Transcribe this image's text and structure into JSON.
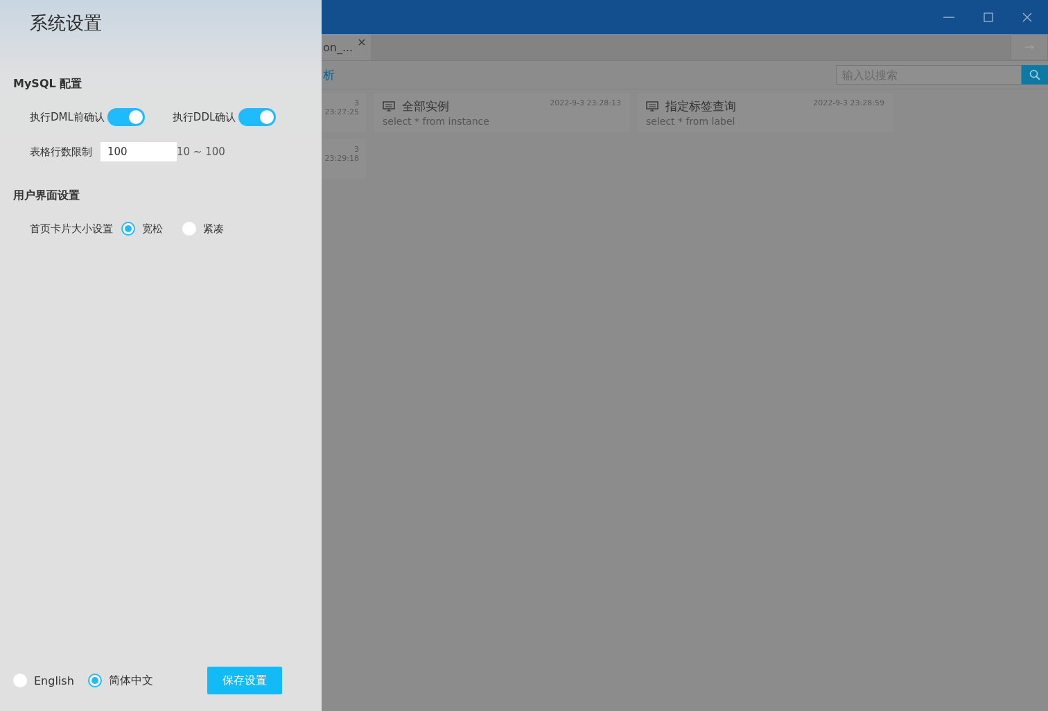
{
  "app": {
    "tab": {
      "label": "on_...",
      "close": "×"
    },
    "toolbar_label": "析",
    "search": {
      "placeholder": "输入以搜索"
    },
    "card_rows": [
      [
        {
          "kind": "cut",
          "time": "3 23:27:25"
        },
        {
          "kind": "full",
          "title": "全部实例",
          "time": "2022-9-3 23:28:13",
          "query": "select * from instance"
        },
        {
          "kind": "full",
          "title": "指定标签查询",
          "time": "2022-9-3 23:28:59",
          "query": "select * from label"
        }
      ],
      [
        {
          "kind": "cut",
          "time": "3 23:29:18"
        }
      ]
    ]
  },
  "settings": {
    "title": "系统设置",
    "sections": [
      {
        "heading": "MySQL 配置",
        "rows": [
          {
            "kind": "switches",
            "items": [
              {
                "label": "执行DML前确认",
                "on": true
              },
              {
                "label": "执行DDL确认",
                "on": true
              }
            ]
          },
          {
            "kind": "number",
            "label": "表格行数限制",
            "value": "100",
            "hint": "10 ~ 100"
          }
        ]
      },
      {
        "heading": "用户界面设置",
        "rows": [
          {
            "kind": "radio",
            "label": "首页卡片大小设置",
            "options": [
              {
                "label": "宽松",
                "selected": true
              },
              {
                "label": "紧凑",
                "selected": false
              }
            ]
          }
        ]
      }
    ],
    "language": [
      {
        "label": "English",
        "selected": false
      },
      {
        "label": "简体中文",
        "selected": true
      }
    ],
    "save_button": "保存设置"
  }
}
